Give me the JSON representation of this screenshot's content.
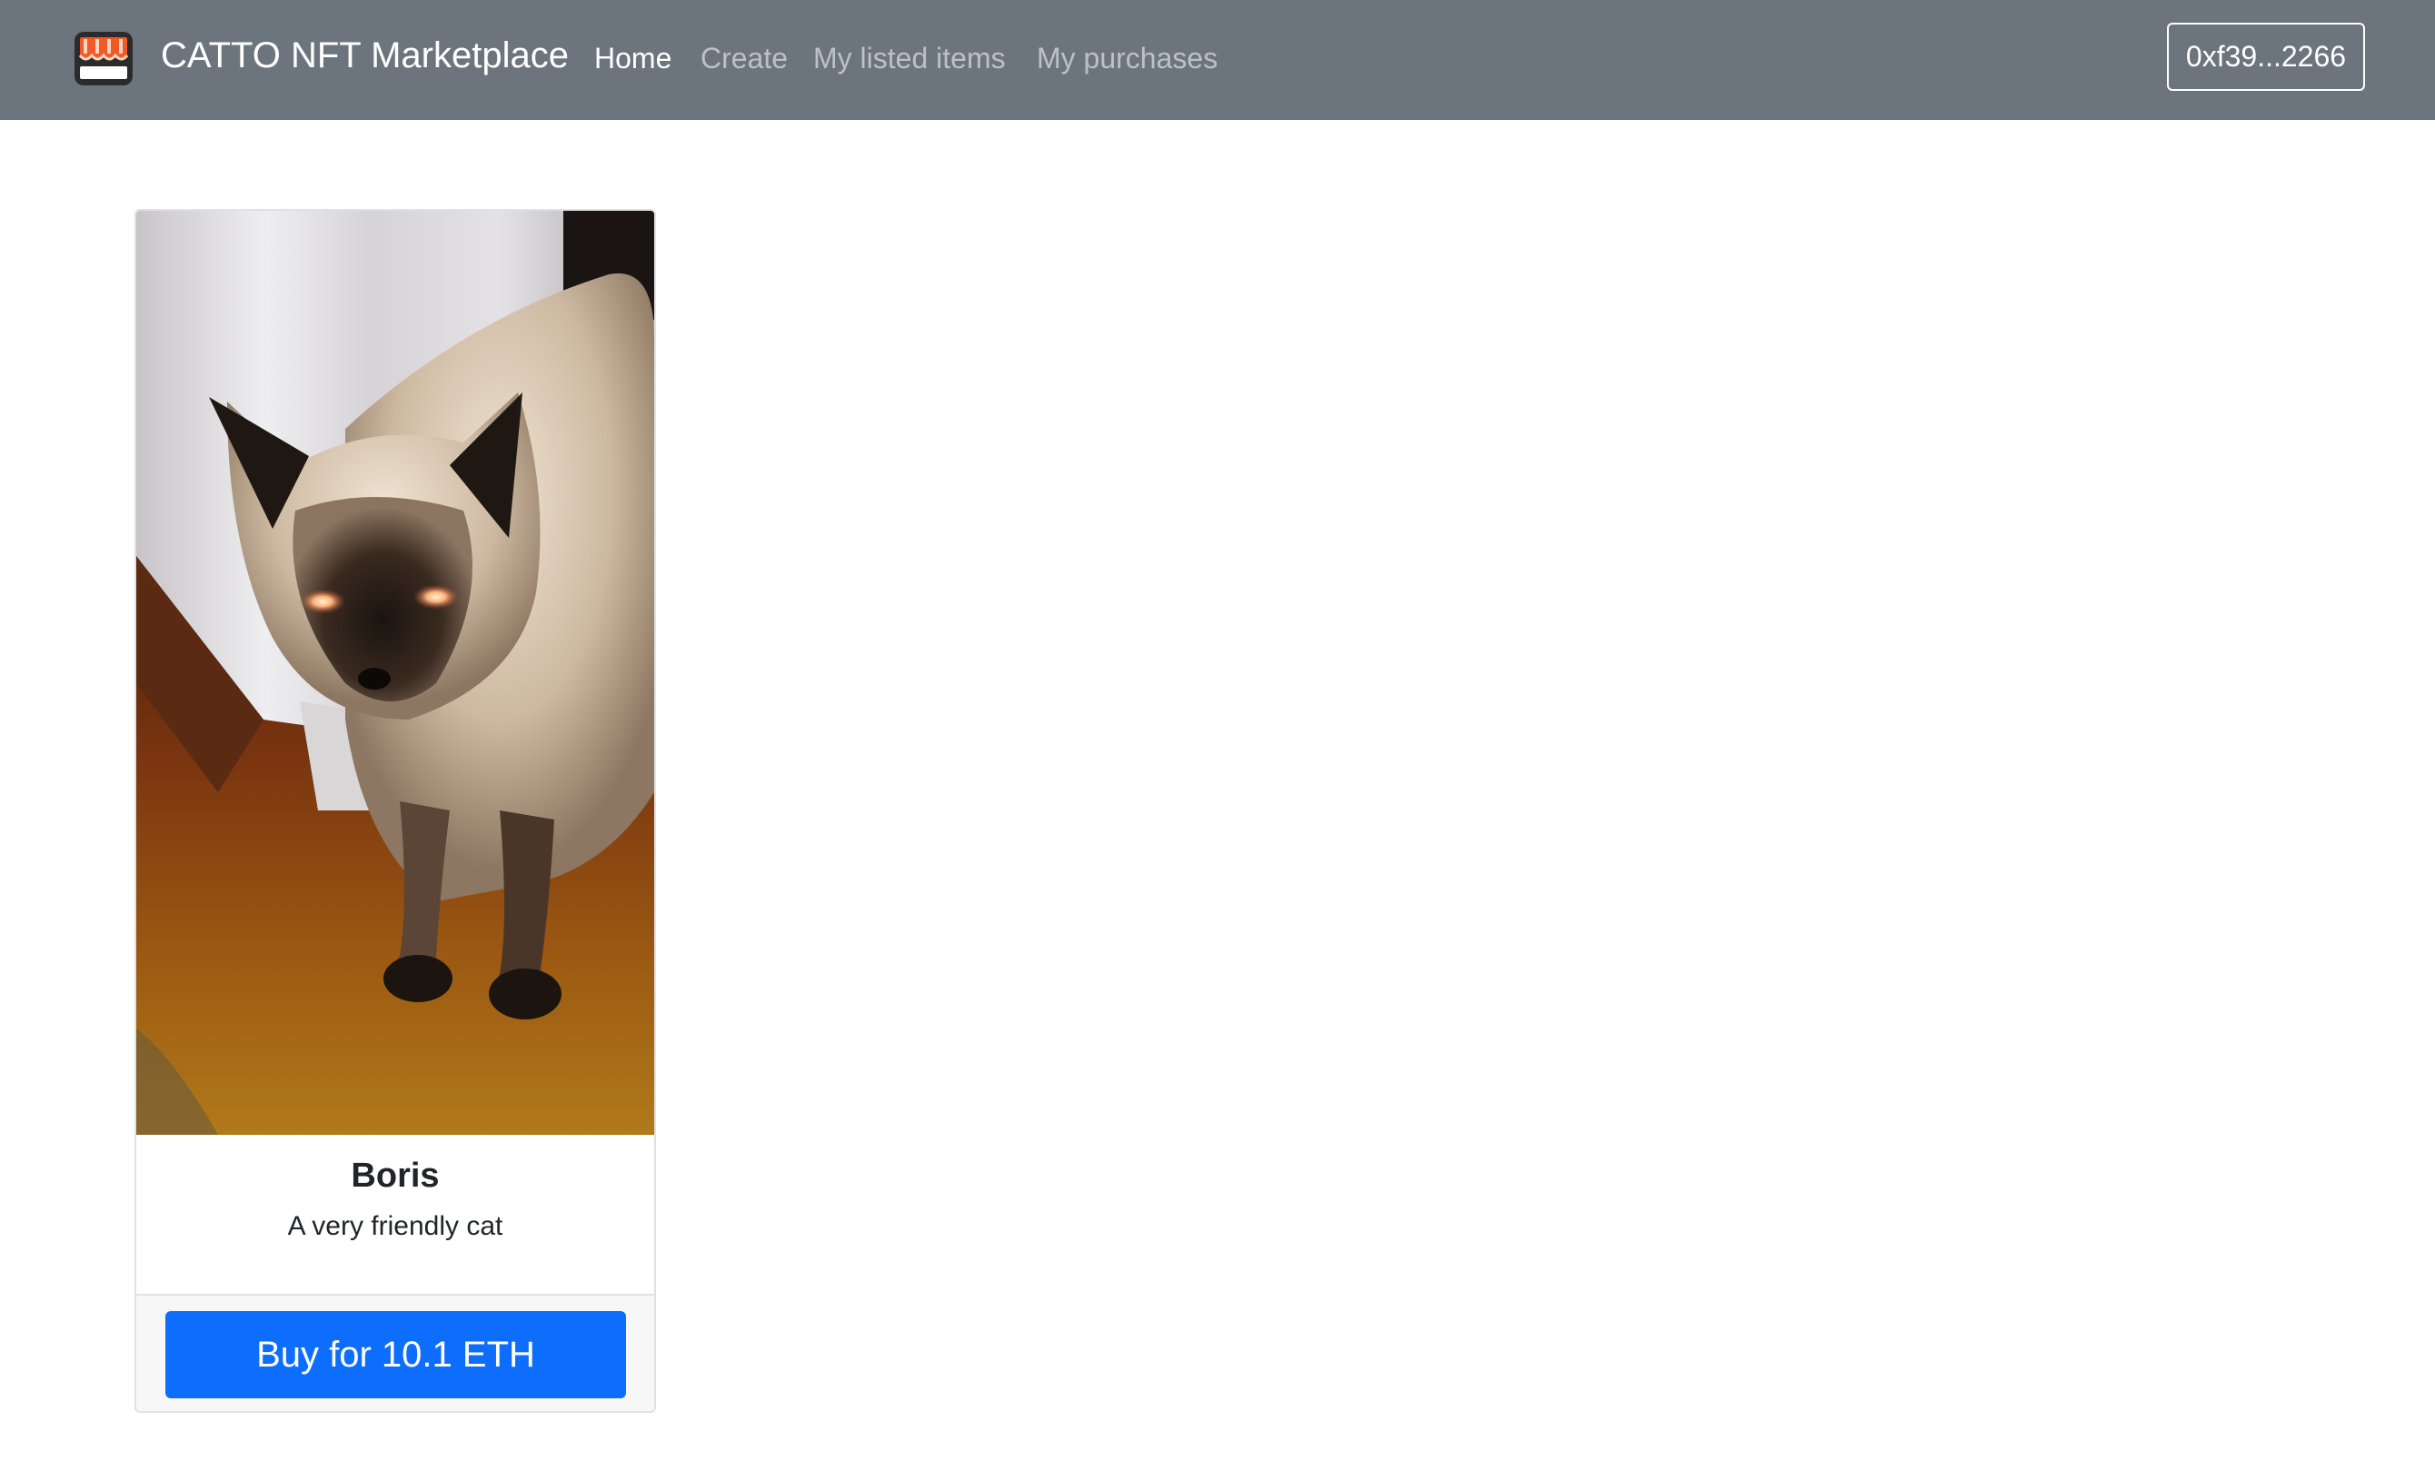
{
  "navbar": {
    "brand_icon": "shop-storefront-icon",
    "brand_name": "CATTO NFT Marketplace",
    "links": [
      {
        "label": "Home",
        "active": true
      },
      {
        "label": "Create",
        "active": false
      },
      {
        "label": "My listed items",
        "active": false
      },
      {
        "label": "My purchases",
        "active": false
      }
    ],
    "account": "0xf39...2266",
    "background_color": "#6c757d"
  },
  "items": [
    {
      "image": "photo of a Siamese cat",
      "name": "Boris",
      "description": "A very friendly cat",
      "buy_label": "Buy for 10.1 ETH",
      "buy_button_color": "#0d6efd"
    }
  ]
}
